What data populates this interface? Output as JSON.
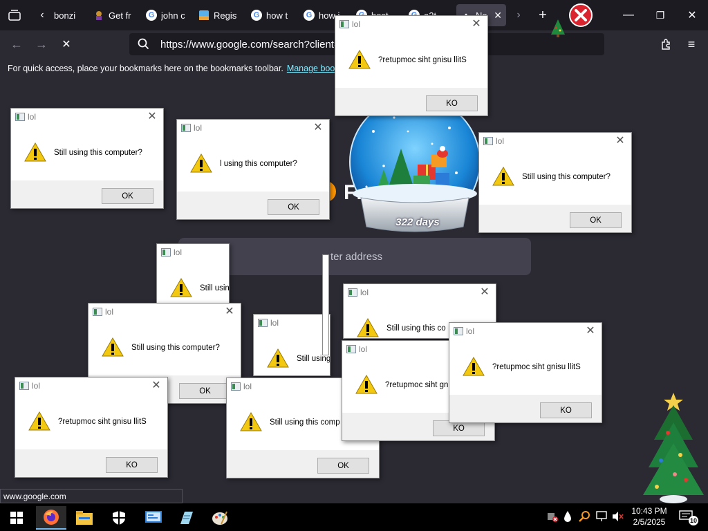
{
  "browser": {
    "tabs": [
      {
        "title": "bonzi",
        "favicon": "bonzi-icon"
      },
      {
        "title": "Get fr",
        "favicon": "bonzi-icon"
      },
      {
        "title": "john c",
        "favicon": "google-icon"
      },
      {
        "title": "Regist",
        "favicon": "site-icon"
      },
      {
        "title": "how t",
        "favicon": "google-icon"
      },
      {
        "title": "how i",
        "favicon": "google-icon"
      },
      {
        "title": "best",
        "favicon": "google-icon"
      },
      {
        "title": "a2t",
        "favicon": "google-icon"
      },
      {
        "title": "Ne",
        "favicon": "loading-icon",
        "active": true
      }
    ],
    "url": "https://www.google.com/search?client=fir",
    "bookmarks_prompt": "For quick access, place your bookmarks here on the bookmarks toolbar.",
    "bookmarks_link": "Manage bookmarks",
    "newtab": {
      "wordmark": "Fi",
      "search_placeholder": "ter address"
    },
    "status_url": "www.google.com"
  },
  "overlay": {
    "snowglobe_label": "322 days"
  },
  "dialogs": [
    {
      "title": "lol",
      "message": "?retupmoc siht gnisu llitS",
      "button": "KO"
    },
    {
      "title": "lol",
      "message": "Still using this computer?",
      "button": "OK"
    },
    {
      "title": "lol",
      "message": "l using this computer?",
      "button": "OK"
    },
    {
      "title": "lol",
      "message": "Still using this computer?",
      "button": "OK"
    },
    {
      "title": "lol",
      "message": "Still usin",
      "button": ""
    },
    {
      "title": "lol",
      "message": "Still using this computer?",
      "button": "OK"
    },
    {
      "title": "lol",
      "message": "Still using",
      "button": ""
    },
    {
      "title": "lol",
      "message": "Still using this co",
      "button": ""
    },
    {
      "title": "lol",
      "message": "?retupmoc siht gnisu llitS",
      "button": "KO"
    },
    {
      "title": "lol",
      "message": "Still using this comp",
      "button": "OK"
    },
    {
      "title": "lol",
      "message": "?retupmoc siht gn",
      "button": "KO"
    },
    {
      "title": "lol",
      "message": "?retupmoc siht gnisu llitS",
      "button": "KO"
    }
  ],
  "taskbar": {
    "clock_time": "10:43 PM",
    "clock_date": "2/5/2025",
    "notification_count": "10",
    "apps": [
      "firefox-icon",
      "file-explorer-icon",
      "security-shield-icon",
      "control-panel-icon",
      "notepad-icon",
      "paint-icon"
    ]
  },
  "colors": {
    "tabbar_bg": "#1c1b22",
    "toolbar_bg": "#2b2a33",
    "link_color": "#80ebff",
    "dialog_footer": "#f0f0f0",
    "warning_yellow": "#f2c811"
  }
}
